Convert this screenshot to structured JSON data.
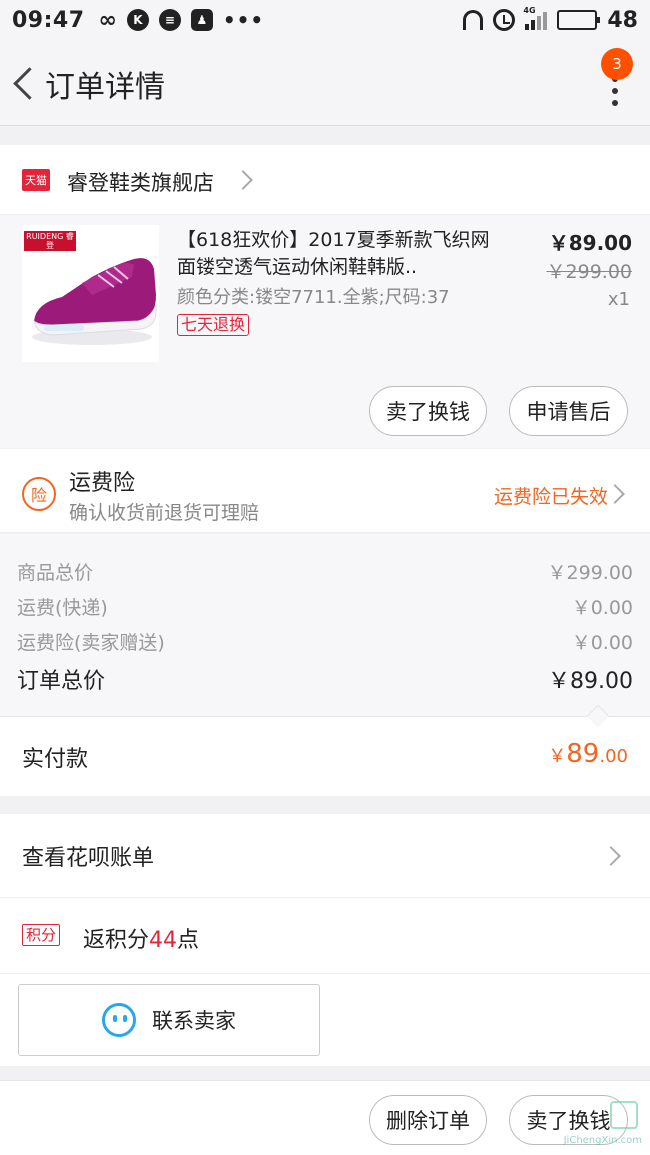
{
  "status_bar": {
    "time": "09:47",
    "icons_left": [
      "infinity-icon",
      "k-app-icon",
      "chat-icon",
      "qq-icon",
      "more-dots-icon"
    ],
    "network": "4G",
    "battery_level": "48"
  },
  "header": {
    "title": "订单详情",
    "badge_count": "3"
  },
  "store": {
    "badge": "天猫",
    "name": "睿登鞋类旗舰店"
  },
  "product": {
    "brand_label": "RUIDENG 睿登",
    "title": "【618狂欢价】2017夏季新款飞织网面镂空透气运动休闲鞋韩版..",
    "spec": "颜色分类:镂空7711.全紫;尺码:37",
    "tag": "七天退换",
    "price": "￥89.00",
    "original_price": "￥299.00",
    "quantity": "x1",
    "buttons": {
      "sell": "卖了换钱",
      "after_sale": "申请售后"
    }
  },
  "insurance": {
    "icon_text": "险",
    "title": "运费险",
    "subtitle": "确认收货前退货可理赔",
    "status": "运费险已失效"
  },
  "summary": {
    "rows": [
      {
        "label": "商品总价",
        "value": "￥299.00"
      },
      {
        "label": "运费(快递)",
        "value": "￥0.00"
      },
      {
        "label": "运费险(卖家赠送)",
        "value": "￥0.00"
      }
    ],
    "total_label": "订单总价",
    "total_value": "￥89.00"
  },
  "paid": {
    "label": "实付款",
    "currency": "￥",
    "integer": "89",
    "decimal": ".00"
  },
  "huabei": {
    "label": "查看花呗账单"
  },
  "points": {
    "tag": "积分",
    "prefix": "返积分",
    "number": "44",
    "suffix": "点"
  },
  "contact": {
    "label": "联系卖家"
  },
  "bottom_bar": {
    "delete_label": "删除订单",
    "sell_label": "卖了换钱"
  },
  "watermark": {
    "text": "JiChengXin.com"
  },
  "colors": {
    "accent": "#f26522",
    "tmall_red": "#e3243a",
    "badge": "#ff5000",
    "wangwang_blue": "#2aa7e8"
  }
}
